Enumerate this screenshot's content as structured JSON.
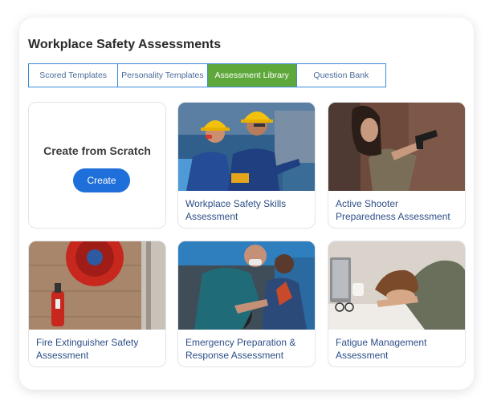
{
  "header": {
    "title": "Workplace Safety Assessments"
  },
  "tabs": [
    {
      "label": "Scored Templates",
      "active": false
    },
    {
      "label": "Personality Templates",
      "active": false
    },
    {
      "label": "Assessment Library",
      "active": true
    },
    {
      "label": "Question Bank",
      "active": false
    }
  ],
  "scratch": {
    "title": "Create from Scratch",
    "button": "Create"
  },
  "cards": [
    {
      "title_line1": "Workplace Safety Skills",
      "title_line2": "Assessment",
      "image": "workers-hard-hats-photo"
    },
    {
      "title_line1": "Active Shooter",
      "title_line2": "Preparedness Assessment",
      "image": "woman-aiming-pistol-photo"
    },
    {
      "title_line1": "Fire Extinguisher Safety",
      "title_line2": "Assessment",
      "image": "fire-extinguisher-hose-reel-photo"
    },
    {
      "title_line1": "Emergency Preparation &",
      "title_line2": "Response Assessment",
      "image": "first-aid-helping-injured-photo"
    },
    {
      "title_line1": "Fatigue Management",
      "title_line2": "Assessment",
      "image": "tired-woman-at-desk-photo"
    }
  ],
  "colors": {
    "tab_active": "#5ea83b",
    "tab_border": "#3d8bd8",
    "button": "#1e6fd9",
    "caption": "#2d4f88"
  }
}
